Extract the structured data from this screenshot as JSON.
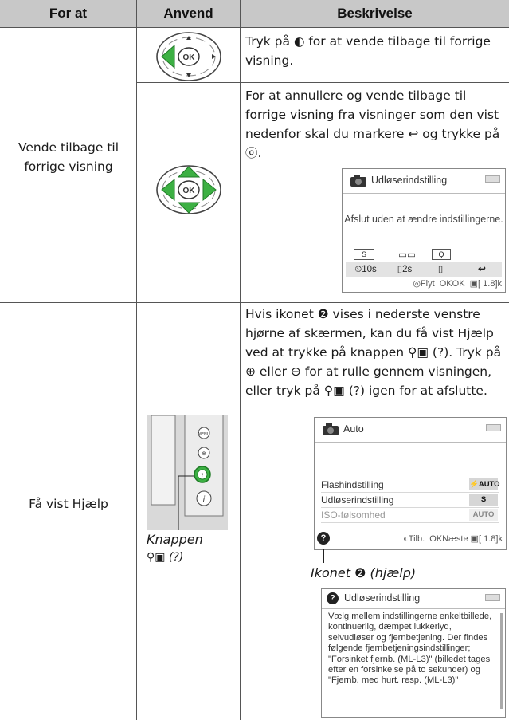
{
  "header": {
    "col1": "For at",
    "col2": "Anvend",
    "col3": "Beskrivelse"
  },
  "rows": [
    {
      "label": "Vende tilbage til forrige visning",
      "desc1": "Tryk på ◐ for at vende tilbage til forrige visning.",
      "desc2": "For at annullere og vende tilbage til forrige visning fra visninger som den vist nedenfor skal du markere ↩ og trykke på ⓞ.",
      "screen": {
        "title": "Udløserindstilling",
        "message": "Afslut uden at ændre indstillingerne.",
        "icons_row1": [
          "S",
          "▭▭",
          "Q"
        ],
        "icons_row2": [
          "⏲10s",
          "▯2s",
          "▯",
          "↩"
        ],
        "footer": "◎Flyt  OKOK  ▣[ 1.8]k"
      }
    },
    {
      "label": "Få vist Hjælp",
      "desc": "Hvis ikonet ❷ vises i nederste venstre hjørne af skærmen, kan du få vist Hjælp ved at trykke på knappen ⚲▣ (?). Tryk på ⊕ eller ⊖ for at rulle gennem visningen, eller tryk på ⚲▣ (?) igen for at afslutte.",
      "knappen_caption_1": "Knappen",
      "knappen_caption_2": "⚲▣ (?)",
      "auto_screen": {
        "title": "Auto",
        "items": [
          {
            "label": "Flashindstilling",
            "value": "⚡AUTO"
          },
          {
            "label": "Udløserindstilling",
            "value": "S"
          },
          {
            "label": "ISO-følsomhed",
            "value": "AUTO"
          }
        ],
        "footer": "◐Tilb.  OKNæste ▣[ 1.8]k"
      },
      "icon_caption": "Ikonet ❷ (hjælp)",
      "help_screen": {
        "title": "Udløserindstilling",
        "text": "Vælg mellem indstillingerne enkeltbillede, kontinuerlig, dæmpet lukkerlyd, selvudløser og fjernbetjening. Der findes følgende fjernbetjeningsindstillinger; \"Forsinket fjernb. (ML-L3)\" (billedet tages efter en forsinkelse på to sekunder) og \"Fjernb. med hurt. resp. (ML-L3)\""
      }
    }
  ]
}
